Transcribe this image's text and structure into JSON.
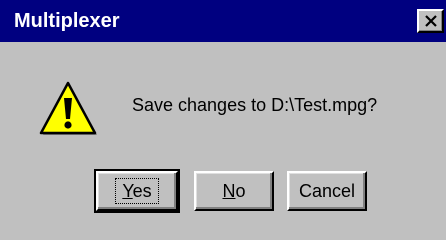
{
  "window": {
    "title": "Multiplexer"
  },
  "icons": {
    "warning": "warning-icon",
    "close": "close-icon"
  },
  "message": "Save changes to D:\\Test.mpg?",
  "buttons": {
    "yes": {
      "mnemonic": "Y",
      "rest": "es"
    },
    "no": {
      "mnemonic": "N",
      "rest": "o"
    },
    "cancel": {
      "label": "Cancel"
    }
  },
  "colors": {
    "titlebar": "#000080",
    "face": "#c0c0c0",
    "warning_fill": "#ffff00"
  }
}
